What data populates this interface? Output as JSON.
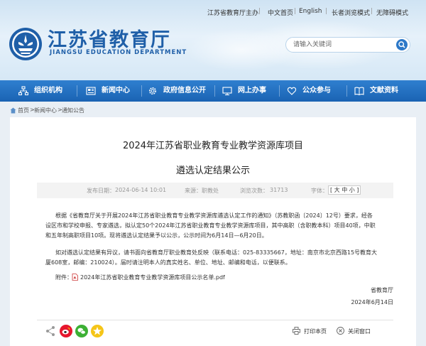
{
  "top_links": {
    "host": "江苏省教育厅主办",
    "chinese_home": "中文首页",
    "english": "English",
    "elder_mode": "长者浏览模式",
    "accessibility": "无障碍模式"
  },
  "logo": {
    "title_cn": "江苏省教育厅",
    "title_en": "JIANGSU EDUCATION DEPARTMENT"
  },
  "search": {
    "placeholder": "请输入关键词"
  },
  "nav": {
    "items": [
      {
        "label": "组织机构",
        "icon": "org-icon"
      },
      {
        "label": "新闻中心",
        "icon": "news-icon"
      },
      {
        "label": "政府信息公开",
        "icon": "gear-icon"
      },
      {
        "label": "网上办事",
        "icon": "monitor-icon"
      },
      {
        "label": "公众参与",
        "icon": "heart-icon"
      },
      {
        "label": "文献资料",
        "icon": "book-icon"
      }
    ]
  },
  "breadcrumb": {
    "items": [
      "首页",
      "新闻中心",
      "通知公告"
    ],
    "separator": ">"
  },
  "article": {
    "title_line1": "2024年江苏省职业教育专业教学资源库项目",
    "title_line2": "遴选认定结果公示",
    "meta": {
      "published_label": "发布日期：",
      "published_value": "2024-06-14 10:01",
      "source_label": "来源：",
      "source_value": "职教处",
      "views_label": "浏览次数：",
      "views_value": "31713",
      "font_label": "字体：",
      "font_sizes": "[ 大 中 小 ]"
    },
    "paragraph1": [
      "根据《省教育厅关于开展2024年江苏省职业教育专业教学资源库遴选认定工作的通知》（苏教职函〔2024〕12号）要求，经各",
      "设区市和学校申报、专家遴选，拟认定50个2024年江苏省职业教育专业教学资源库项目，其中高职（含职教本科）项目40项，中职",
      "和五年制高职项目10项。现将遴选认定结果予以公示，公示时间为6月14日—6月20日。"
    ],
    "paragraph2": [
      "如对遴选认定结果有异议，请书面向省教育厅职业教育处反映（联系电话：025-83335667，地址：南京市北京西路15号教育大",
      "厦608室，邮编：210024）。届时请注明本人的真实姓名、单位、地址、邮编和电话，以便联系。"
    ],
    "attachment_label": "附件：",
    "attachment_name": "2024年江苏省职业教育专业教学资源库项目公示名单.pdf",
    "signature": "省教育厅",
    "date": "2024年6月14日"
  },
  "footer_actions": {
    "print": "打印本页",
    "close": "关闭窗口"
  },
  "colors": {
    "brand_blue": "#1f5fa8",
    "nav_blue": "#1a63b3"
  }
}
